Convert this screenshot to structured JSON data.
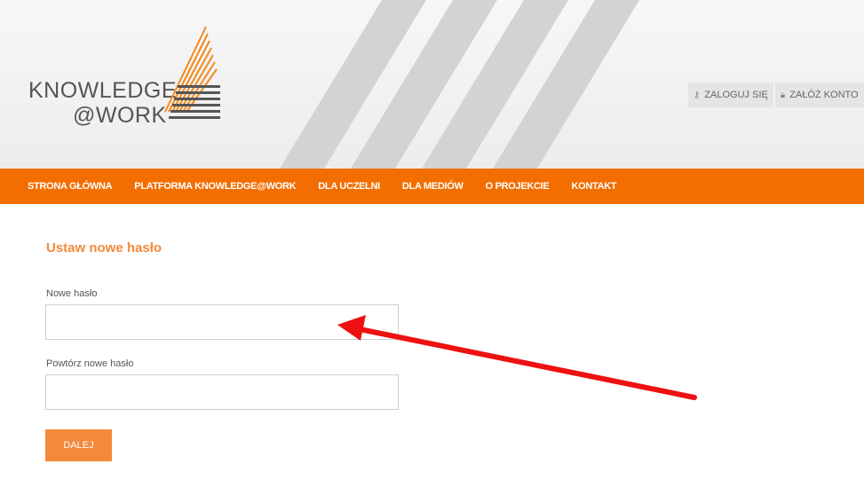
{
  "logo": {
    "line1": "KNOWLEDGE",
    "line2": "@WORK"
  },
  "auth": {
    "login_icon": "key-icon",
    "login_label": "ZALOGUJ SIĘ",
    "register_icon": "lock-icon",
    "register_label": "ZAŁÓŻ KONTO"
  },
  "nav": {
    "items": [
      "STRONA GŁÓWNA",
      "PLATFORMA KNOWLEDGE@WORK",
      "DLA UCZELNI",
      "DLA MEDIÓW",
      "O PROJEKCIE",
      "KONTAKT"
    ]
  },
  "form": {
    "title": "Ustaw nowe hasło",
    "new_password_label": "Nowe hasło",
    "new_password_value": "",
    "repeat_password_label": "Powtórz nowe hasło",
    "repeat_password_value": "",
    "submit_label": "DALEJ"
  },
  "colors": {
    "brand_orange": "#f26e00",
    "title_orange": "#f4893a",
    "annotation_arrow": "#ee1111"
  }
}
